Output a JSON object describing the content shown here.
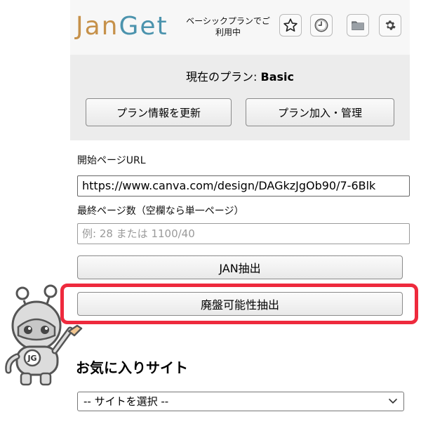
{
  "header": {
    "logo_part1": "Jan",
    "logo_part2": "Get",
    "plan_note_line1": "ベーシックプランでご",
    "plan_note_line2": "利用中",
    "tools": [
      "star-icon",
      "clock-icon",
      "folder-icon",
      "gear-icon"
    ]
  },
  "plan": {
    "current_prefix": "現在のプラン: ",
    "current_value": "Basic",
    "refresh_button": "プラン情報を更新",
    "manage_button": "プラン加入・管理"
  },
  "form": {
    "start_url_label": "開始ページURL",
    "start_url_value": "https://www.canva.com/design/DAGkzJgOb90/7-6Blk",
    "last_page_label": "最終ページ数（空欄なら単一ページ）",
    "last_page_placeholder": "例: 28 または 1100/40",
    "jan_button": "JAN抽出",
    "discontinued_button": "廃盤可能性抽出"
  },
  "favorites": {
    "title": "お気に入りサイト",
    "select_value": "-- サイトを選択 --"
  },
  "mascot": {
    "badge": "JG"
  },
  "colors": {
    "logo_gold": "#c6914a",
    "logo_blue": "#4b93ad",
    "highlight_red": "#ee2a3d"
  }
}
